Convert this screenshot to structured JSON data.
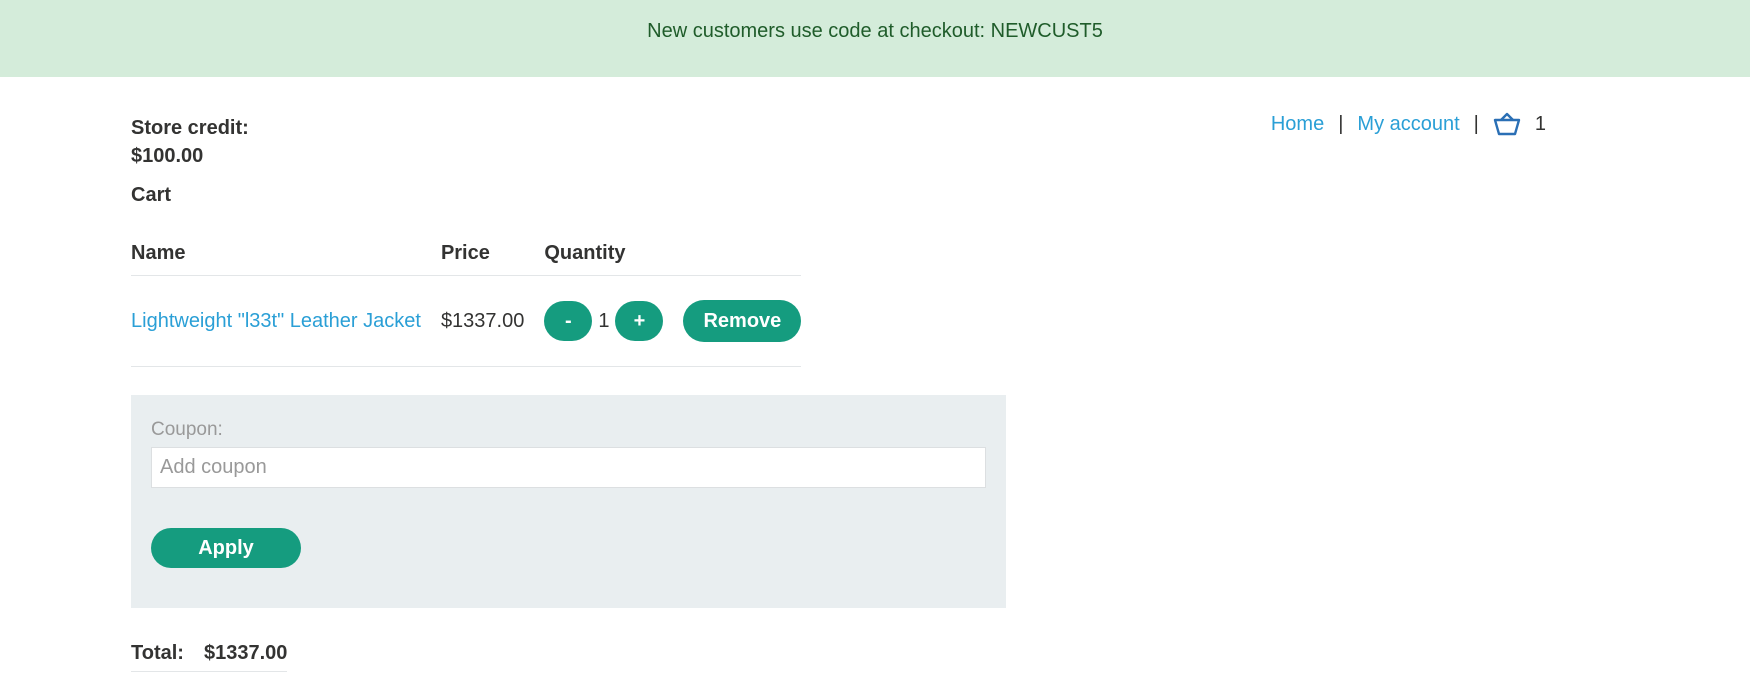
{
  "banner": {
    "text": "New customers use code at checkout: NEWCUST5"
  },
  "nav": {
    "home": "Home",
    "separator": "|",
    "account": "My account",
    "cart_icon": "basket-icon",
    "cart_count": "1"
  },
  "store_credit": {
    "label": "Store credit:",
    "value": "$100.00"
  },
  "cart": {
    "heading": "Cart",
    "columns": [
      "Name",
      "Price",
      "Quantity"
    ],
    "items": [
      {
        "name": "Lightweight \"l33t\" Leather Jacket",
        "price": "$1337.00",
        "quantity": "1",
        "decrement_label": "-",
        "increment_label": "+",
        "remove_label": "Remove"
      }
    ]
  },
  "coupon": {
    "label": "Coupon:",
    "placeholder": "Add coupon",
    "value": "",
    "apply_label": "Apply"
  },
  "total": {
    "label": "Total:",
    "value": "$1337.00"
  },
  "colors": {
    "banner_bg": "#d4ecda",
    "banner_text": "#1f5c2a",
    "link": "#2a9fd6",
    "button": "#159c7f",
    "panel_bg": "#e9eef0"
  }
}
